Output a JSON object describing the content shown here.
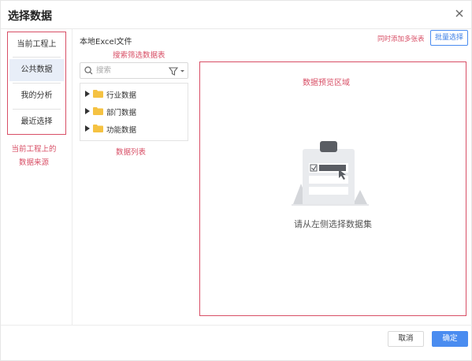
{
  "dialog": {
    "title": "选择数据",
    "close_icon": "close-icon"
  },
  "sidebar": {
    "items": [
      {
        "label": "当前工程上",
        "active": false
      },
      {
        "label": "公共数据",
        "active": true
      },
      {
        "label": "我的分析",
        "active": false
      },
      {
        "label": "最近选择",
        "active": false
      }
    ],
    "annotation_line1": "当前工程上的",
    "annotation_line2": "数据来源"
  },
  "middle": {
    "local_excel_label": "本地Excel文件",
    "search_annotation": "搜索筛选数据表",
    "search": {
      "placeholder": "搜索",
      "value": ""
    },
    "filter_icon": "filter-icon",
    "tree": [
      {
        "label": "行业数据",
        "icon": "folder-icon"
      },
      {
        "label": "部门数据",
        "icon": "folder-icon"
      },
      {
        "label": "功能数据",
        "icon": "folder-icon"
      }
    ],
    "list_annotation": "数据列表"
  },
  "top_right": {
    "multi_annotation": "同时添加多张表",
    "batch_select_label": "批量选择"
  },
  "preview": {
    "annotation": "数据预览区域",
    "empty_text": "请从左侧选择数据集",
    "illustration_icon": "clipboard-illustration-icon"
  },
  "footer": {
    "cancel_label": "取消",
    "ok_label": "确定"
  },
  "colors": {
    "annotation_red": "#d84f66",
    "primary_blue": "#4a8cf0",
    "active_bg": "#e8eef8"
  }
}
